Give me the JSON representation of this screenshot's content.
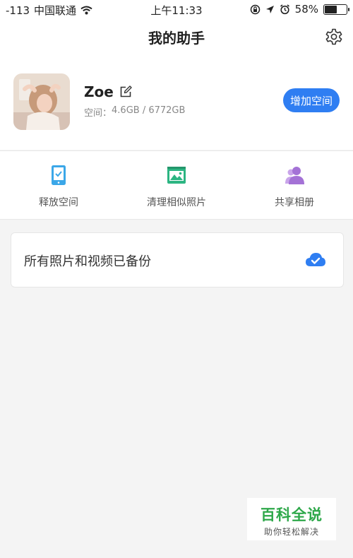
{
  "status_bar": {
    "signal": "-113",
    "carrier": "中国联通",
    "time": "上午11:33",
    "battery_percent": "58%",
    "battery_level": 0.58,
    "icons": [
      "wifi-icon",
      "rotation-lock-icon",
      "location-icon",
      "alarm-icon",
      "battery-icon"
    ]
  },
  "header": {
    "title": "我的助手",
    "settings_icon": "gear-icon"
  },
  "profile": {
    "username": "Zoe",
    "storage_label": "空间：",
    "storage_value": "4.6GB / 6772GB",
    "add_space_label": "增加空间",
    "accent_color": "#2f7ef2"
  },
  "actions": [
    {
      "label": "释放空间",
      "icon": "phone-check-icon",
      "color": "#3ba7e8"
    },
    {
      "label": "清理相似照片",
      "icon": "photo-icon",
      "color": "#2cb582"
    },
    {
      "label": "共享相册",
      "icon": "shared-people-icon",
      "color": "#a472d6"
    }
  ],
  "backup": {
    "text": "所有照片和视频已备份",
    "icon": "cloud-check-icon",
    "color": "#2f7ef2"
  },
  "watermark": {
    "title": "百科全说",
    "subtitle": "助你轻松解决"
  }
}
